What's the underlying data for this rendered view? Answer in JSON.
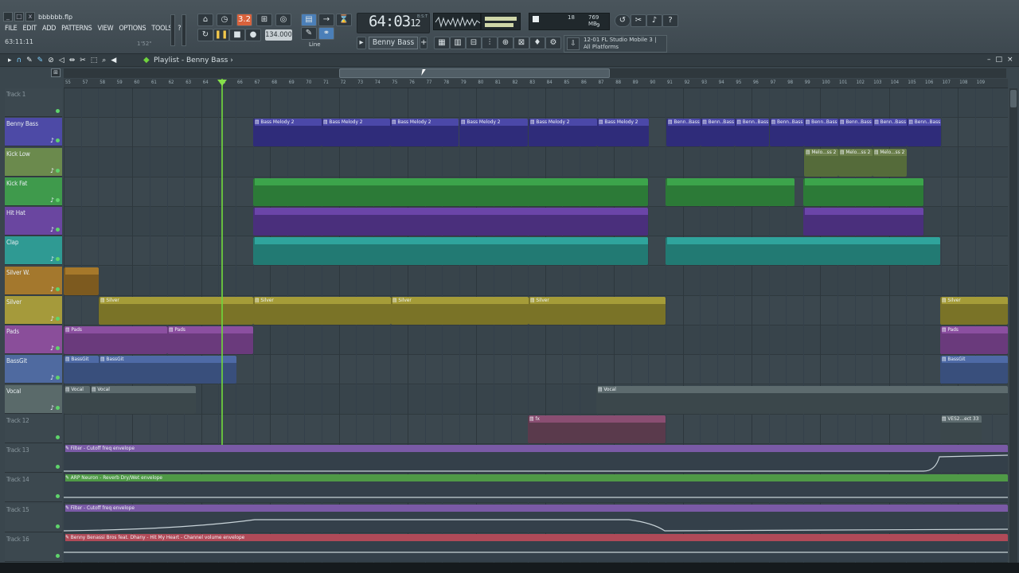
{
  "window": {
    "file_name": "bbbbbb.flp",
    "close": "x",
    "minimize": "_",
    "restore": "□"
  },
  "menu": [
    "FILE",
    "EDIT",
    "ADD",
    "PATTERNS",
    "VIEW",
    "OPTIONS",
    "TOOLS",
    "?"
  ],
  "hint": {
    "position": "63:11:11",
    "time": "1'52\""
  },
  "transport": {
    "time_main": "64:03",
    "time_sub": "12",
    "time_unit": "B:S:T",
    "tempo": "134.000",
    "pat_song": "3.2",
    "snap_label": "Line"
  },
  "cpu": {
    "value": "18",
    "memory": "769 MB",
    "polyphony": "9"
  },
  "pattern_selector": "Benny Bass",
  "news": {
    "line1": "12-01  FL Studio Mobile 3 |",
    "line2": "All Platforms"
  },
  "playlist": {
    "title": "Playlist - Benny Bass",
    "arrow": "›"
  },
  "ruler": [
    "55",
    "57",
    "58",
    "59",
    "60",
    "61",
    "62",
    "63",
    "64",
    "65",
    "66",
    "67",
    "68",
    "69",
    "70",
    "71",
    "72",
    "73",
    "74",
    "75",
    "76",
    "77",
    "78",
    "79",
    "80",
    "81",
    "82",
    "83",
    "84",
    "85",
    "86",
    "87",
    "88",
    "89",
    "90",
    "91",
    "92",
    "93",
    "94",
    "95",
    "96",
    "97",
    "98",
    "99",
    "100",
    "101",
    "102",
    "103",
    "104",
    "105",
    "106",
    "107",
    "108",
    "109"
  ],
  "tracks": [
    {
      "name": "Track 1",
      "color": "#3a464d",
      "dim": true
    },
    {
      "name": "Benny Bass",
      "color": "#4d4aa6"
    },
    {
      "name": "Kick Low",
      "color": "#6b8a4d"
    },
    {
      "name": "Kick Fat",
      "color": "#3f9a4c"
    },
    {
      "name": "Hit Hat",
      "color": "#6a46a0"
    },
    {
      "name": "Clap",
      "color": "#2f9a93"
    },
    {
      "name": "Silver W.",
      "color": "#a4782d"
    },
    {
      "name": "Silver",
      "color": "#a59a3b"
    },
    {
      "name": "Pads",
      "color": "#8a4e9a"
    },
    {
      "name": "BassGit",
      "color": "#4f6aa0"
    },
    {
      "name": "Vocal",
      "color": "#5a6a6a"
    },
    {
      "name": "Track 12",
      "color": "#3a464d",
      "dim": true
    },
    {
      "name": "Track 13",
      "color": "#3a464d",
      "dim": true
    },
    {
      "name": "Track 14",
      "color": "#3a464d",
      "dim": true
    },
    {
      "name": "Track 15",
      "color": "#3a464d",
      "dim": true
    },
    {
      "name": "Track 16",
      "color": "#3a464d",
      "dim": true
    }
  ],
  "clips": {
    "benny": {
      "label": "Bass Melody 2",
      "short": "Benn..Bass",
      "color": "#4b48a8",
      "body": "#2f2c7a"
    },
    "kicklow": {
      "label": "Melo...ss 2",
      "color": "#6a7e4a",
      "body": "#556b3a"
    },
    "kickfat": {
      "color": "#3ca44b",
      "body": "#2c7a37"
    },
    "hithat": {
      "color": "#6b45a8",
      "body": "#4a2f7c"
    },
    "clap": {
      "color": "#2fa49c",
      "body": "#227a73"
    },
    "silverw": {
      "color": "#a6782a",
      "body": "#7d5a1f"
    },
    "silver": {
      "label": "Silver",
      "color": "#a59c38",
      "body": "#7a7327"
    },
    "pads": {
      "label": "Pads",
      "color": "#8b4fa0",
      "body": "#6a3a7c"
    },
    "bassgit": {
      "label": "BassGit",
      "color": "#4e6aa6",
      "body": "#394f7c"
    },
    "vocal": {
      "label": "Vocal",
      "color": "#5d6b6e",
      "body": "#3b474b"
    },
    "fx": {
      "label": "fx",
      "color": "#8a4e72",
      "body": "#5a3a4c"
    },
    "ves": {
      "label": "VES2...ect 33",
      "color": "#5d6b6e",
      "body": "#3b474b"
    },
    "auto13": {
      "label": "Filter - Cutoff freq envelope",
      "color": "#7a5aa6"
    },
    "auto14": {
      "label": "ARP Neuron - Reverb Dry/Wet envelope",
      "color": "#4f9a46"
    },
    "auto15": {
      "label": "Filter - Cutoff freq envelope",
      "color": "#7a5aa6"
    },
    "auto16": {
      "label": "Benny Benassi Bros feat. Dhany - Hit My Heart - Channel volume envelope",
      "color": "#b04a58"
    }
  }
}
